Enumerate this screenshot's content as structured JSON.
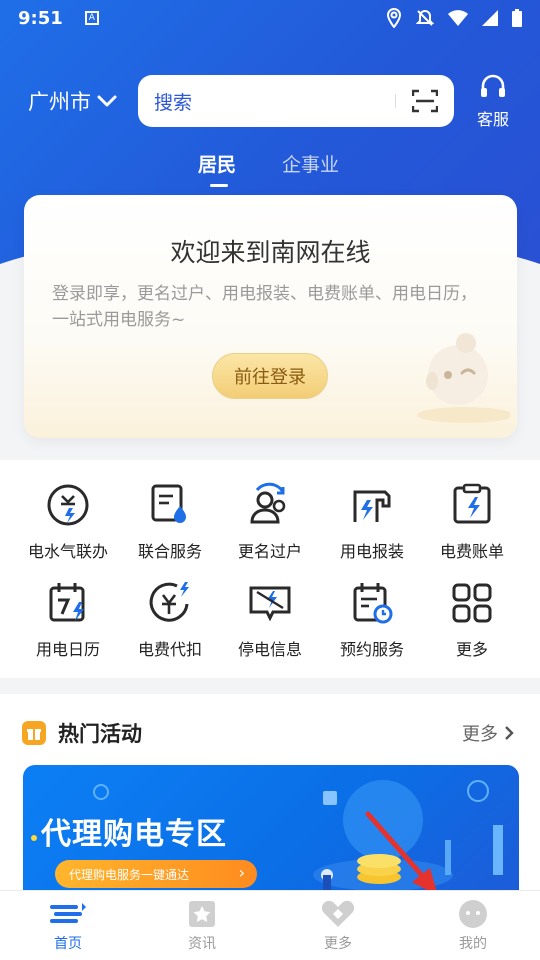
{
  "status": {
    "time": "9:51"
  },
  "header": {
    "city": "广州市",
    "search_placeholder": "搜索",
    "service_label": "客服",
    "tabs": [
      "居民",
      "企事业"
    ]
  },
  "welcome": {
    "title": "欢迎来到南网在线",
    "description": "登录即享，更名过户、用电报装、电费账单、用电日历，一站式用电服务~",
    "login_button": "前往登录"
  },
  "services": [
    {
      "label": "电水气联办",
      "icon": "utility-link-icon"
    },
    {
      "label": "联合服务",
      "icon": "joint-service-icon"
    },
    {
      "label": "更名过户",
      "icon": "transfer-icon"
    },
    {
      "label": "用电报装",
      "icon": "install-icon"
    },
    {
      "label": "电费账单",
      "icon": "bill-icon"
    },
    {
      "label": "用电日历",
      "icon": "calendar-icon"
    },
    {
      "label": "电费代扣",
      "icon": "auto-debit-icon"
    },
    {
      "label": "停电信息",
      "icon": "outage-icon"
    },
    {
      "label": "预约服务",
      "icon": "appointment-icon"
    },
    {
      "label": "更多",
      "icon": "grid-icon"
    }
  ],
  "activities": {
    "title": "热门活动",
    "more_label": "更多",
    "banner_title": "代理购电专区",
    "banner_button": "代理购电服务一键通达"
  },
  "bottom_nav": [
    {
      "label": "首页",
      "active": true
    },
    {
      "label": "资讯",
      "active": false
    },
    {
      "label": "更多",
      "active": false
    },
    {
      "label": "我的",
      "active": false
    }
  ],
  "colors": {
    "brand": "#1f6fe8",
    "accent": "#f6a623",
    "annotation": "#e5322d"
  }
}
